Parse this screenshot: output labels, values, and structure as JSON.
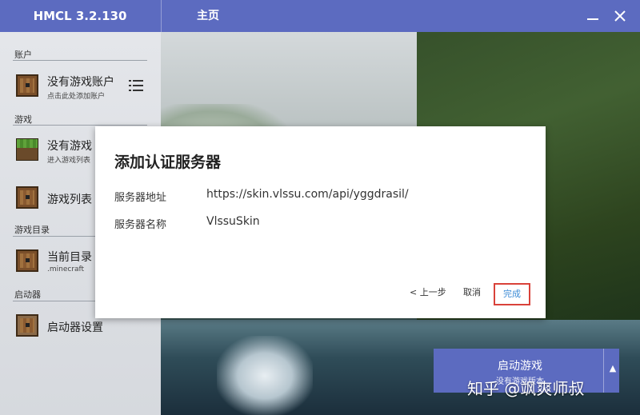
{
  "app": {
    "title": "HMCL 3.2.130",
    "page_title": "主页"
  },
  "window_controls": {
    "minimize_icon": "minimize-icon",
    "close_icon": "close-icon"
  },
  "sidebar": {
    "sections": {
      "account": "账户",
      "game": "游戏",
      "game_dir": "游戏目录",
      "launcher": "启动器"
    },
    "items": [
      {
        "label": "没有游戏账户",
        "sublabel": "点击此处添加账户",
        "icon": "chest-icon"
      },
      {
        "label": "没有游戏",
        "sublabel": "进入游戏列表",
        "icon": "grass-block-icon"
      },
      {
        "label": "游戏列表",
        "sublabel": "",
        "icon": "chest-icon"
      },
      {
        "label": "当前目录",
        "sublabel": ".minecraft",
        "icon": "chest-icon"
      },
      {
        "label": "启动器设置",
        "sublabel": "",
        "icon": "chest-icon"
      }
    ]
  },
  "dialog": {
    "title": "添加认证服务器",
    "fields": [
      {
        "label": "服务器地址",
        "value": "https://skin.vlssu.com/api/yggdrasil/"
      },
      {
        "label": "服务器名称",
        "value": "VlssuSkin"
      }
    ],
    "buttons": {
      "back": "< 上一步",
      "cancel": "取消",
      "done": "完成"
    },
    "accent": "#3b8bd6",
    "highlight": "#d9423a"
  },
  "launch": {
    "label": "启动游戏",
    "sublabel": "没有游戏版本",
    "arrow": "▲"
  },
  "watermark": "知乎 @飒爽师叔",
  "colors": {
    "titlebar": "#5c6bc0",
    "sidebar": "#e4e6ea"
  }
}
